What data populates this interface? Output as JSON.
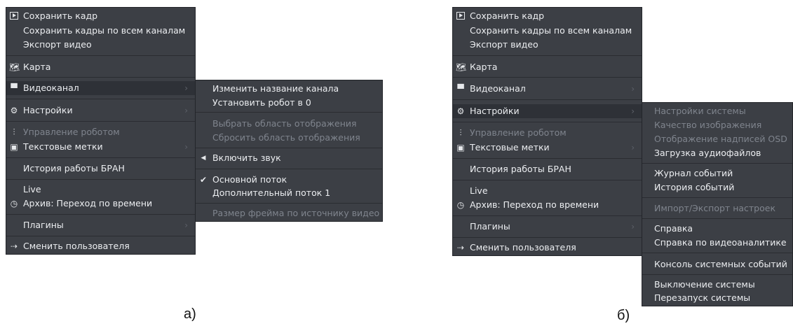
{
  "left_menu": {
    "items": [
      {
        "label": "Сохранить кадр",
        "icon": "play-icon",
        "enabled": true
      },
      {
        "label": "Сохранить кадры по всем каналам",
        "enabled": true
      },
      {
        "label": "Экспорт видео",
        "enabled": true
      },
      {
        "label": "Карта",
        "icon": "map-icon",
        "enabled": true
      },
      {
        "label": "Видеоканал",
        "icon": "camera-icon",
        "enabled": true,
        "submenu": true,
        "highlighted": true
      },
      {
        "label": "Настройки",
        "icon": "gears-icon",
        "enabled": true,
        "submenu": true
      },
      {
        "label": "Управление роботом",
        "icon": "sliders-icon",
        "enabled": false
      },
      {
        "label": "Текстовые метки",
        "icon": "text-label-icon",
        "enabled": true,
        "submenu": true
      },
      {
        "label": "История работы БРАН",
        "enabled": true
      },
      {
        "label": "Live",
        "enabled": true
      },
      {
        "label": "Архив: Переход по времени",
        "icon": "clock-icon",
        "enabled": true
      },
      {
        "label": "Плагины",
        "enabled": true,
        "submenu": true
      },
      {
        "label": "Сменить пользователя",
        "icon": "user-switch-icon",
        "enabled": true
      }
    ]
  },
  "left_submenu": {
    "items": [
      {
        "label": "Изменить название канала",
        "enabled": true
      },
      {
        "label": "Установить робот в 0",
        "enabled": true
      },
      {
        "label": "Выбрать область отображения",
        "enabled": false
      },
      {
        "label": "Сбросить область отображения",
        "enabled": false
      },
      {
        "label": "Включить звук",
        "icon": "speaker-icon",
        "enabled": true
      },
      {
        "label": "Основной поток",
        "icon": "check-icon",
        "enabled": true
      },
      {
        "label": "Дополнительный поток 1",
        "enabled": true
      },
      {
        "label": "Размер фрейма по источнику видео",
        "enabled": false
      }
    ]
  },
  "right_menu": {
    "items": [
      {
        "label": "Сохранить кадр",
        "icon": "play-icon",
        "enabled": true
      },
      {
        "label": "Сохранить кадры по всем каналам",
        "enabled": true
      },
      {
        "label": "Экспорт видео",
        "enabled": true
      },
      {
        "label": "Карта",
        "icon": "map-icon",
        "enabled": true
      },
      {
        "label": "Видеоканал",
        "icon": "camera-icon",
        "enabled": true,
        "submenu": true
      },
      {
        "label": "Настройки",
        "icon": "gears-icon",
        "enabled": true,
        "submenu": true,
        "highlighted": true
      },
      {
        "label": "Управление роботом",
        "icon": "sliders-icon",
        "enabled": false
      },
      {
        "label": "Текстовые метки",
        "icon": "text-label-icon",
        "enabled": true,
        "submenu": true
      },
      {
        "label": "История работы БРАН",
        "enabled": true
      },
      {
        "label": "Live",
        "enabled": true
      },
      {
        "label": "Архив: Переход по времени",
        "icon": "clock-icon",
        "enabled": true
      },
      {
        "label": "Плагины",
        "enabled": true,
        "submenu": true
      },
      {
        "label": "Сменить пользователя",
        "icon": "user-switch-icon",
        "enabled": true
      }
    ]
  },
  "right_submenu": {
    "items": [
      {
        "label": "Настройки системы",
        "enabled": false
      },
      {
        "label": "Качество изображения",
        "enabled": false
      },
      {
        "label": "Отображение надписей OSD",
        "enabled": false
      },
      {
        "label": "Загрузка аудиофайлов",
        "enabled": true
      },
      {
        "label": "Журнал событий",
        "enabled": true
      },
      {
        "label": "История событий",
        "enabled": true
      },
      {
        "label": "Импорт/Экспорт настроек",
        "enabled": false
      },
      {
        "label": "Справка",
        "enabled": true
      },
      {
        "label": "Справка по видеоаналитике",
        "enabled": true
      },
      {
        "label": "Консоль системных событий",
        "enabled": true
      },
      {
        "label": "Выключение системы",
        "enabled": true
      },
      {
        "label": "Перезапуск системы",
        "enabled": true
      }
    ]
  },
  "captions": {
    "left": "а)",
    "right": "б)"
  },
  "colors": {
    "menu_bg": "#3c3f45",
    "highlight": "#2e3137",
    "text": "#eceef1",
    "disabled": "#7f848d"
  }
}
